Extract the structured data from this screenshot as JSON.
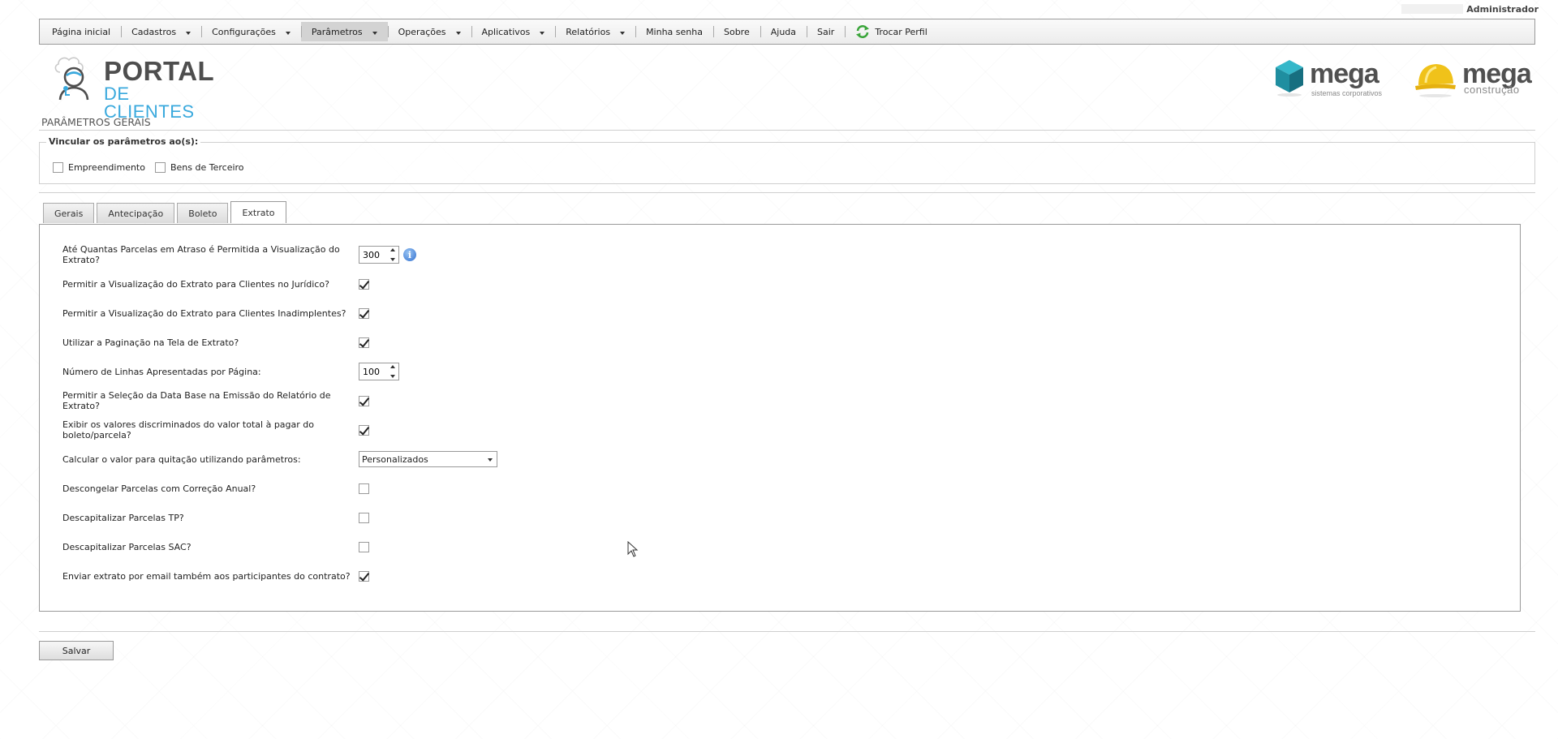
{
  "user": {
    "name": "Administrador"
  },
  "menu": {
    "items": [
      {
        "label": "Página inicial"
      },
      {
        "label": "Cadastros"
      },
      {
        "label": "Configurações"
      },
      {
        "label": "Parâmetros"
      },
      {
        "label": "Operações"
      },
      {
        "label": "Aplicativos"
      },
      {
        "label": "Relatórios"
      },
      {
        "label": "Minha senha"
      },
      {
        "label": "Sobre"
      },
      {
        "label": "Ajuda"
      },
      {
        "label": "Sair"
      },
      {
        "label": "Trocar Perfil"
      }
    ]
  },
  "logos": {
    "portal_line1": "PORTAL",
    "portal_line2": "DE CLIENTES",
    "mega1_word": "mega",
    "mega1_sub": "sistemas corporativos",
    "mega2_word": "mega",
    "mega2_sub": "construção"
  },
  "page": {
    "title": "PARÂMETROS GERAIS"
  },
  "binding": {
    "legend": "Vincular os parâmetros ao(s):",
    "options": [
      {
        "label": "Empreendimento",
        "checked": false
      },
      {
        "label": "Bens de Terceiro",
        "checked": false
      }
    ]
  },
  "tabs": [
    {
      "label": "Gerais"
    },
    {
      "label": "Antecipação"
    },
    {
      "label": "Boleto"
    },
    {
      "label": "Extrato",
      "active": true
    }
  ],
  "extrato": {
    "rows": [
      {
        "label": "Até Quantas Parcelas em Atraso é Permitida a Visualização do Extrato?",
        "type": "number",
        "value": "300"
      },
      {
        "label": "Permitir a Visualização do Extrato para Clientes no Jurídico?",
        "type": "checkbox",
        "checked": true
      },
      {
        "label": "Permitir a Visualização do Extrato para Clientes Inadimplentes?",
        "type": "checkbox",
        "checked": true
      },
      {
        "label": "Utilizar a Paginação na Tela de Extrato?",
        "type": "checkbox",
        "checked": true
      },
      {
        "label": "Número de Linhas Apresentadas por Página:",
        "type": "number",
        "value": "100"
      },
      {
        "label": "Permitir a Seleção da Data Base na Emissão do Relatório de Extrato?",
        "type": "checkbox",
        "checked": true
      },
      {
        "label": "Exibir os valores discriminados do valor total à pagar do boleto/parcela?",
        "type": "checkbox",
        "checked": true
      },
      {
        "label": "Calcular o valor para quitação utilizando parâmetros:",
        "type": "select",
        "value": "Personalizados"
      },
      {
        "label": "Descongelar Parcelas com Correção Anual?",
        "type": "checkbox",
        "checked": false
      },
      {
        "label": "Descapitalizar Parcelas TP?",
        "type": "checkbox",
        "checked": false
      },
      {
        "label": "Descapitalizar Parcelas SAC?",
        "type": "checkbox",
        "checked": false
      },
      {
        "label": "Enviar extrato por email também aos participantes do contrato?",
        "type": "checkbox",
        "checked": true
      }
    ]
  },
  "actions": {
    "save_label": "Salvar"
  },
  "colors": {
    "portal_blue": "#3aa9dd",
    "mega_teal": "#2aa5b8",
    "mega_yellow": "#f0c21a",
    "info_blue": "#2f6fd0"
  }
}
